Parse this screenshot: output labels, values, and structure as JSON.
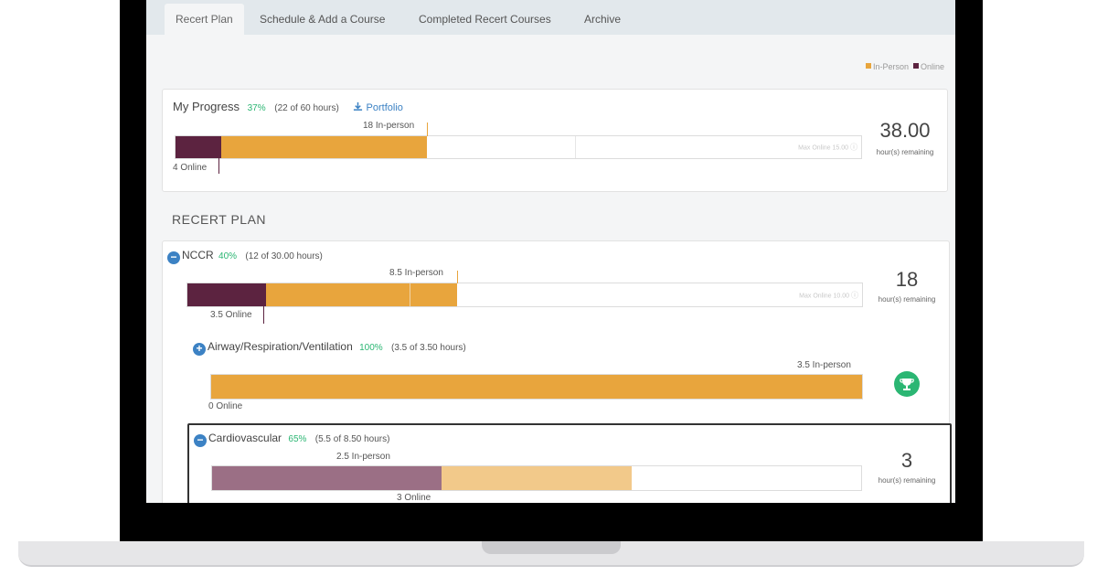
{
  "colors": {
    "in_person": "#e8a53d",
    "online": "#5c2340",
    "in_person_light": "#f2c98a",
    "online_light": "#9b6f85",
    "accent_green": "#2bb673",
    "link_blue": "#3c82c4"
  },
  "tabs": [
    {
      "label": "Recert Plan",
      "active": true
    },
    {
      "label": "Schedule & Add a Course",
      "active": false
    },
    {
      "label": "Completed Recert Courses",
      "active": false
    },
    {
      "label": "Archive",
      "active": false
    }
  ],
  "legend": {
    "in_person": "In-Person",
    "online": "Online"
  },
  "progress": {
    "title": "My Progress",
    "pct": "37%",
    "hours": "(22 of 60 hours)",
    "portfolio": "Portfolio",
    "in_person_label": "18 In-person",
    "online_label": "4 Online",
    "online_value": 4,
    "in_person_value": 18,
    "total": 60,
    "max_online": "Max Online 15.00",
    "remaining_num": "38.00",
    "remaining_txt": "hour(s) remaining"
  },
  "section_title": "RECERT PLAN",
  "nccr": {
    "title": "NCCR",
    "pct": "40%",
    "hours": "(12 of 30.00 hours)",
    "in_person_label": "8.5 In-person",
    "online_label": "3.5 Online",
    "online_value": 3.5,
    "in_person_value": 8.5,
    "total": 30,
    "max_online": "Max Online 10.00",
    "remaining_num": "18",
    "remaining_txt": "hour(s) remaining"
  },
  "airway": {
    "title": "Airway/Respiration/Ventilation",
    "pct": "100%",
    "hours": "(3.5 of 3.50 hours)",
    "in_person_label": "3.5 In-person",
    "online_label": "0 Online",
    "online_value": 0,
    "in_person_value": 3.5,
    "total": 3.5
  },
  "cardio": {
    "title": "Cardiovascular",
    "pct": "65%",
    "hours": "(5.5 of 8.50 hours)",
    "in_person_label": "2.5 In-person",
    "online_label": "3 Online",
    "online_value": 3,
    "in_person_value": 2.5,
    "total": 8.5,
    "remaining_num": "3",
    "remaining_txt": "hour(s) remaining"
  }
}
